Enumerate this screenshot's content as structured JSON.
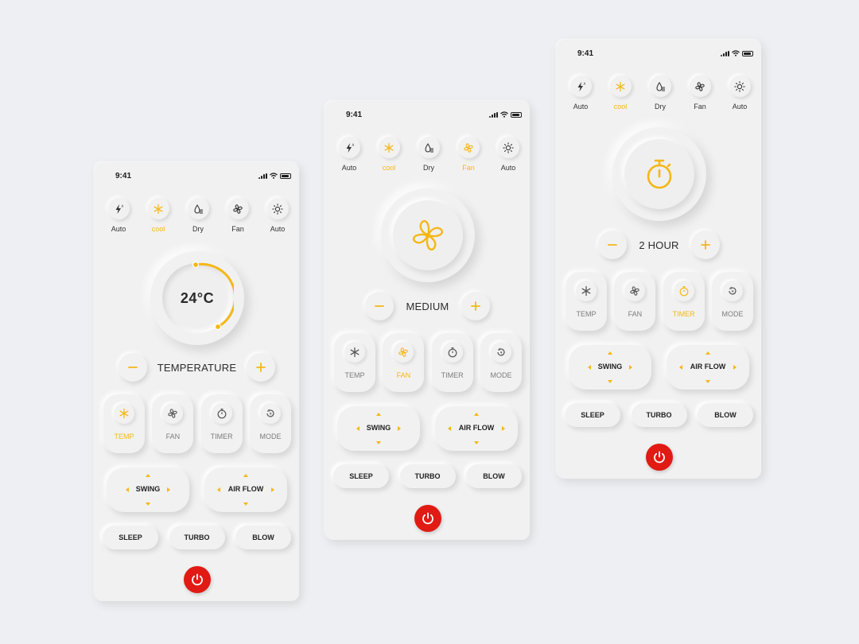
{
  "status_time": "9:41",
  "modes": [
    {
      "label": "Auto",
      "icon": "bolt-auto-icon"
    },
    {
      "label": "cool",
      "icon": "snowflake-icon"
    },
    {
      "label": "Dry",
      "icon": "drop-icon"
    },
    {
      "label": "Fan",
      "icon": "fan-icon"
    },
    {
      "label": "Auto",
      "icon": "sun-icon"
    }
  ],
  "controls": [
    {
      "label": "TEMP",
      "icon": "snowflake-icon"
    },
    {
      "label": "FAN",
      "icon": "fan-icon"
    },
    {
      "label": "TIMER",
      "icon": "stopwatch-icon"
    },
    {
      "label": "MODE",
      "icon": "mode-icon"
    }
  ],
  "pads": {
    "swing": "SWING",
    "airflow": "AIR FLOW"
  },
  "pills": {
    "sleep": "SLEEP",
    "turbo": "TURBO",
    "blow": "BLOW"
  },
  "screens": {
    "temperature": {
      "value": "24°C",
      "stepper_label": "TEMPERATURE",
      "active_modes": [
        "cool"
      ],
      "active_control": "TEMP"
    },
    "fan": {
      "stepper_label": "MEDIUM",
      "active_modes": [
        "cool",
        "Fan"
      ],
      "active_control": "FAN"
    },
    "timer": {
      "stepper_label": "2 HOUR",
      "active_modes": [
        "cool"
      ],
      "active_control": "TIMER"
    }
  },
  "colors": {
    "accent": "#f5b716",
    "power": "#e11a14",
    "background": "#edeff2",
    "card": "#f1f1f1"
  }
}
